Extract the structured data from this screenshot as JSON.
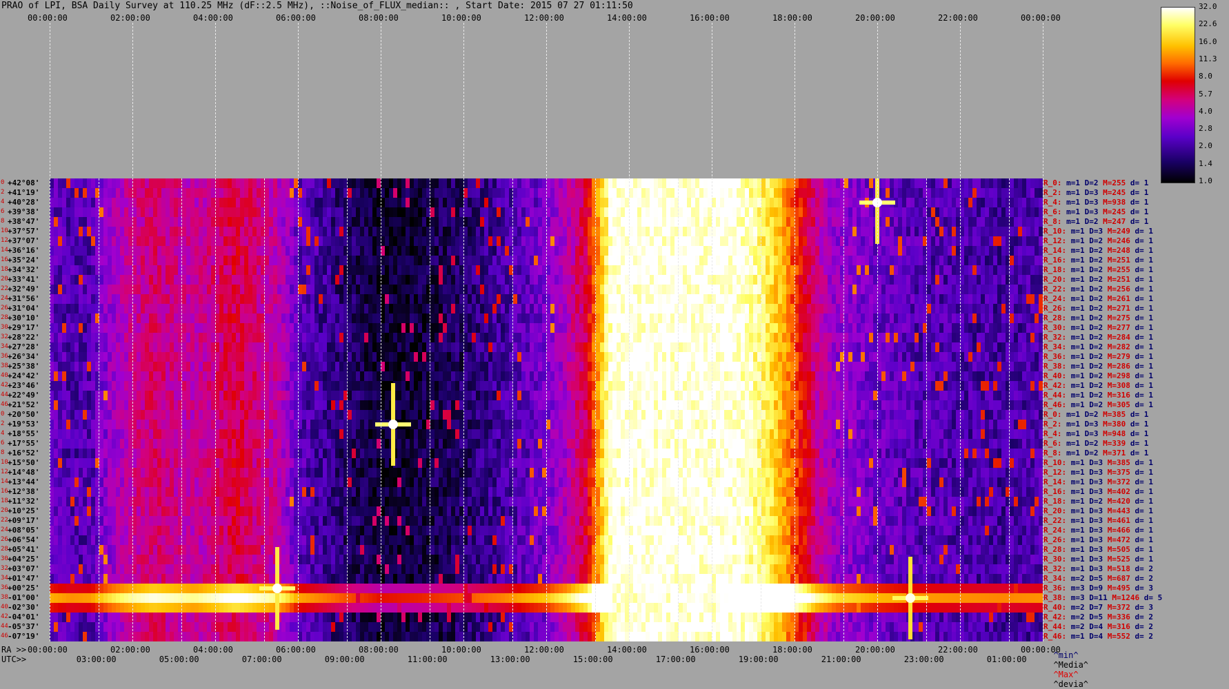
{
  "title": "PRAO of LPI, BSA Daily Survey at 110.25 MHz (dF::2.5 MHz), ::Noise_of_FLUX_median:: , Start Date: 2015 07 27 01:11:50",
  "top_axis_ticks": [
    "00:00:00",
    "02:00:00",
    "04:00:00",
    "06:00:00",
    "08:00:00",
    "10:00:00",
    "12:00:00",
    "14:00:00",
    "16:00:00",
    "18:00:00",
    "20:00:00",
    "22:00:00",
    "00:00:00"
  ],
  "bottom_ra_label": "RA >>",
  "bottom_ra_ticks": [
    "00:00:00",
    "02:00:00",
    "04:00:00",
    "06:00:00",
    "08:00:00",
    "10:00:00",
    "12:00:00",
    "14:00:00",
    "16:00:00",
    "18:00:00",
    "20:00:00",
    "22:00:00",
    "00:00:00"
  ],
  "bottom_utc_label": "UTC>>",
  "bottom_utc_ticks": [
    "03:00:00",
    "05:00:00",
    "07:00:00",
    "09:00:00",
    "11:00:00",
    "13:00:00",
    "15:00:00",
    "17:00:00",
    "19:00:00",
    "21:00:00",
    "23:00:00",
    "01:00:00"
  ],
  "colorbar": {
    "ticks": [
      "32.0",
      "22.6",
      "16.0",
      "11.3",
      "8.0",
      "5.7",
      "4.0",
      "2.8",
      "2.0",
      "1.4",
      "1.0"
    ]
  },
  "legend": {
    "min": "^min^",
    "media": "^Media^",
    "max": "^Max^",
    "devia": "^devia^"
  },
  "declinations": [
    "+42°08'",
    "+41°19'",
    "+40°28'",
    "+39°38'",
    "+38°47'",
    "+37°57'",
    "+37°07'",
    "+36°16'",
    "+35°24'",
    "+34°32'",
    "+33°41'",
    "+32°49'",
    "+31°56'",
    "+31°04'",
    "+30°10'",
    "+29°17'",
    "+28°22'",
    "+27°28'",
    "+26°34'",
    "+25°38'",
    "+24°42'",
    "+23°46'",
    "+22°49'",
    "+21°52'",
    "+20°50'",
    "+19°53'",
    "+18°55'",
    "+17°55'",
    "+16°52'",
    "+15°50'",
    "+14°48'",
    "+13°44'",
    "+12°38'",
    "+11°32'",
    "+10°25'",
    "+09°17'",
    "+08°05'",
    "+06°54'",
    "+05°41'",
    "+04°25'",
    "+03°07'",
    "+01°47'",
    "+00°25'",
    "-01°00'",
    "-02°30'",
    "-04°01'",
    "-05°37'",
    "-07°19'"
  ],
  "row_indices": [
    "0",
    "2",
    "4",
    "6",
    "8",
    "10",
    "12",
    "14",
    "16",
    "18",
    "20",
    "22",
    "24",
    "26",
    "28",
    "30",
    "32",
    "34",
    "36",
    "38",
    "40",
    "42",
    "44",
    "46",
    "0",
    "2",
    "4",
    "6",
    "8",
    "10",
    "12",
    "14",
    "16",
    "18",
    "20",
    "22",
    "24",
    "26",
    "28",
    "30",
    "32",
    "34",
    "36",
    "38",
    "40",
    "42",
    "44",
    "46"
  ],
  "right_rows": [
    {
      "r": "R_0:",
      "m": "m=1",
      "D": "D=2",
      "M": "M=255",
      "d": "d= 1"
    },
    {
      "r": "R_2:",
      "m": "m=1",
      "D": "D=3",
      "M": "M=245",
      "d": "d= 1"
    },
    {
      "r": "R_4:",
      "m": "m=1",
      "D": "D=3",
      "M": "M=938",
      "d": "d= 1"
    },
    {
      "r": "R_6:",
      "m": "m=1",
      "D": "D=3",
      "M": "M=245",
      "d": "d= 1"
    },
    {
      "r": "R_8:",
      "m": "m=1",
      "D": "D=2",
      "M": "M=247",
      "d": "d= 1"
    },
    {
      "r": "R_10:",
      "m": "m=1",
      "D": "D=3",
      "M": "M=249",
      "d": "d= 1"
    },
    {
      "r": "R_12:",
      "m": "m=1",
      "D": "D=2",
      "M": "M=246",
      "d": "d= 1"
    },
    {
      "r": "R_14:",
      "m": "m=1",
      "D": "D=2",
      "M": "M=248",
      "d": "d= 1"
    },
    {
      "r": "R_16:",
      "m": "m=1",
      "D": "D=2",
      "M": "M=251",
      "d": "d= 1"
    },
    {
      "r": "R_18:",
      "m": "m=1",
      "D": "D=2",
      "M": "M=255",
      "d": "d= 1"
    },
    {
      "r": "R_20:",
      "m": "m=1",
      "D": "D=2",
      "M": "M=251",
      "d": "d= 1"
    },
    {
      "r": "R_22:",
      "m": "m=1",
      "D": "D=2",
      "M": "M=256",
      "d": "d= 1"
    },
    {
      "r": "R_24:",
      "m": "m=1",
      "D": "D=2",
      "M": "M=261",
      "d": "d= 1"
    },
    {
      "r": "R_26:",
      "m": "m=1",
      "D": "D=2",
      "M": "M=271",
      "d": "d= 1"
    },
    {
      "r": "R_28:",
      "m": "m=1",
      "D": "D=2",
      "M": "M=275",
      "d": "d= 1"
    },
    {
      "r": "R_30:",
      "m": "m=1",
      "D": "D=2",
      "M": "M=277",
      "d": "d= 1"
    },
    {
      "r": "R_32:",
      "m": "m=1",
      "D": "D=2",
      "M": "M=284",
      "d": "d= 1"
    },
    {
      "r": "R_34:",
      "m": "m=1",
      "D": "D=2",
      "M": "M=282",
      "d": "d= 1"
    },
    {
      "r": "R_36:",
      "m": "m=1",
      "D": "D=2",
      "M": "M=279",
      "d": "d= 1"
    },
    {
      "r": "R_38:",
      "m": "m=1",
      "D": "D=2",
      "M": "M=286",
      "d": "d= 1"
    },
    {
      "r": "R_40:",
      "m": "m=1",
      "D": "D=2",
      "M": "M=298",
      "d": "d= 1"
    },
    {
      "r": "R_42:",
      "m": "m=1",
      "D": "D=2",
      "M": "M=308",
      "d": "d= 1"
    },
    {
      "r": "R_44:",
      "m": "m=1",
      "D": "D=2",
      "M": "M=316",
      "d": "d= 1"
    },
    {
      "r": "R_46:",
      "m": "m=1",
      "D": "D=2",
      "M": "M=305",
      "d": "d= 1"
    },
    {
      "r": "R_0:",
      "m": "m=1",
      "D": "D=2",
      "M": "M=385",
      "d": "d= 1"
    },
    {
      "r": "R_2:",
      "m": "m=1",
      "D": "D=3",
      "M": "M=380",
      "d": "d= 1"
    },
    {
      "r": "R_4:",
      "m": "m=1",
      "D": "D=3",
      "M": "M=948",
      "d": "d= 1"
    },
    {
      "r": "R_6:",
      "m": "m=1",
      "D": "D=2",
      "M": "M=339",
      "d": "d= 1"
    },
    {
      "r": "R_8:",
      "m": "m=1",
      "D": "D=2",
      "M": "M=371",
      "d": "d= 1"
    },
    {
      "r": "R_10:",
      "m": "m=1",
      "D": "D=3",
      "M": "M=385",
      "d": "d= 1"
    },
    {
      "r": "R_12:",
      "m": "m=1",
      "D": "D=3",
      "M": "M=375",
      "d": "d= 1"
    },
    {
      "r": "R_14:",
      "m": "m=1",
      "D": "D=3",
      "M": "M=372",
      "d": "d= 1"
    },
    {
      "r": "R_16:",
      "m": "m=1",
      "D": "D=3",
      "M": "M=402",
      "d": "d= 1"
    },
    {
      "r": "R_18:",
      "m": "m=1",
      "D": "D=2",
      "M": "M=420",
      "d": "d= 1"
    },
    {
      "r": "R_20:",
      "m": "m=1",
      "D": "D=3",
      "M": "M=443",
      "d": "d= 1"
    },
    {
      "r": "R_22:",
      "m": "m=1",
      "D": "D=3",
      "M": "M=461",
      "d": "d= 1"
    },
    {
      "r": "R_24:",
      "m": "m=1",
      "D": "D=3",
      "M": "M=466",
      "d": "d= 1"
    },
    {
      "r": "R_26:",
      "m": "m=1",
      "D": "D=3",
      "M": "M=472",
      "d": "d= 1"
    },
    {
      "r": "R_28:",
      "m": "m=1",
      "D": "D=3",
      "M": "M=505",
      "d": "d= 1"
    },
    {
      "r": "R_30:",
      "m": "m=1",
      "D": "D=3",
      "M": "M=525",
      "d": "d= 1"
    },
    {
      "r": "R_32:",
      "m": "m=1",
      "D": "D=3",
      "M": "M=518",
      "d": "d= 2"
    },
    {
      "r": "R_34:",
      "m": "m=2",
      "D": "D=5",
      "M": "M=687",
      "d": "d= 2"
    },
    {
      "r": "R_36:",
      "m": "m=3",
      "D": "D=9",
      "M": "M=495",
      "d": "d= 3"
    },
    {
      "r": "R_38:",
      "m": "m=3",
      "D": "D=11",
      "M": "M=1246",
      "d": "d= 5"
    },
    {
      "r": "R_40:",
      "m": "m=2",
      "D": "D=7",
      "M": "M=372",
      "d": "d= 3"
    },
    {
      "r": "R_42:",
      "m": "m=2",
      "D": "D=5",
      "M": "M=336",
      "d": "d= 2"
    },
    {
      "r": "R_44:",
      "m": "m=2",
      "D": "D=4",
      "M": "M=316",
      "d": "d= 2"
    },
    {
      "r": "R_46:",
      "m": "m=1",
      "D": "D=4",
      "M": "M=552",
      "d": "d= 2"
    }
  ],
  "chart_data": {
    "type": "heatmap",
    "title": "PRAO of LPI, BSA Daily Survey at 110.25 MHz (dF::2.5 MHz), ::Noise_of_FLUX_median:: , Start Date: 2015 07 27 01:11:50",
    "x_axis": "RA / UTC (hours)",
    "rows": 48,
    "color_scale": "log",
    "color_range": [
      1.0,
      32.0
    ],
    "colormap": [
      "#000000",
      "#1a0066",
      "#5a00c8",
      "#a000d0",
      "#d20080",
      "#e00000",
      "#ff6a00",
      "#ffc000",
      "#ffff66",
      "#ffffff"
    ],
    "ra_hour_profile": [
      {
        "ra": 0.0,
        "level": 2.3
      },
      {
        "ra": 0.5,
        "level": 2.0
      },
      {
        "ra": 1.0,
        "level": 2.1
      },
      {
        "ra": 1.5,
        "level": 3.2
      },
      {
        "ra": 2.0,
        "level": 4.2
      },
      {
        "ra": 2.5,
        "level": 5.0
      },
      {
        "ra": 3.0,
        "level": 4.5
      },
      {
        "ra": 3.5,
        "level": 4.0
      },
      {
        "ra": 4.0,
        "level": 4.8
      },
      {
        "ra": 4.5,
        "level": 5.8
      },
      {
        "ra": 5.0,
        "level": 4.8
      },
      {
        "ra": 5.5,
        "level": 4.0
      },
      {
        "ra": 6.0,
        "level": 2.2
      },
      {
        "ra": 7.0,
        "level": 1.6
      },
      {
        "ra": 8.0,
        "level": 1.2
      },
      {
        "ra": 9.0,
        "level": 1.3
      },
      {
        "ra": 10.0,
        "level": 1.5
      },
      {
        "ra": 11.0,
        "level": 1.9
      },
      {
        "ra": 12.0,
        "level": 2.6
      },
      {
        "ra": 12.5,
        "level": 3.6
      },
      {
        "ra": 13.0,
        "level": 6.0
      },
      {
        "ra": 13.3,
        "level": 14.0
      },
      {
        "ra": 13.6,
        "level": 32.0
      },
      {
        "ra": 16.5,
        "level": 32.0
      },
      {
        "ra": 17.0,
        "level": 26.0
      },
      {
        "ra": 17.5,
        "level": 18.0
      },
      {
        "ra": 18.0,
        "level": 9.0
      },
      {
        "ra": 18.5,
        "level": 4.5
      },
      {
        "ra": 19.0,
        "level": 3.0
      },
      {
        "ra": 20.0,
        "level": 2.4
      },
      {
        "ra": 21.0,
        "level": 2.1
      },
      {
        "ra": 22.0,
        "level": 2.0
      },
      {
        "ra": 23.0,
        "level": 1.9
      },
      {
        "ra": 24.0,
        "level": 2.0
      }
    ],
    "bright_band_rows": [
      42,
      43,
      44
    ],
    "point_sources": [
      {
        "ra": 8.3,
        "row": 25,
        "level": 32.0
      },
      {
        "ra": 20.0,
        "row": 2,
        "level": 32.0
      },
      {
        "ra": 5.5,
        "row": 42,
        "level": 32.0
      },
      {
        "ra": 20.8,
        "row": 43,
        "level": 30.0
      }
    ]
  }
}
